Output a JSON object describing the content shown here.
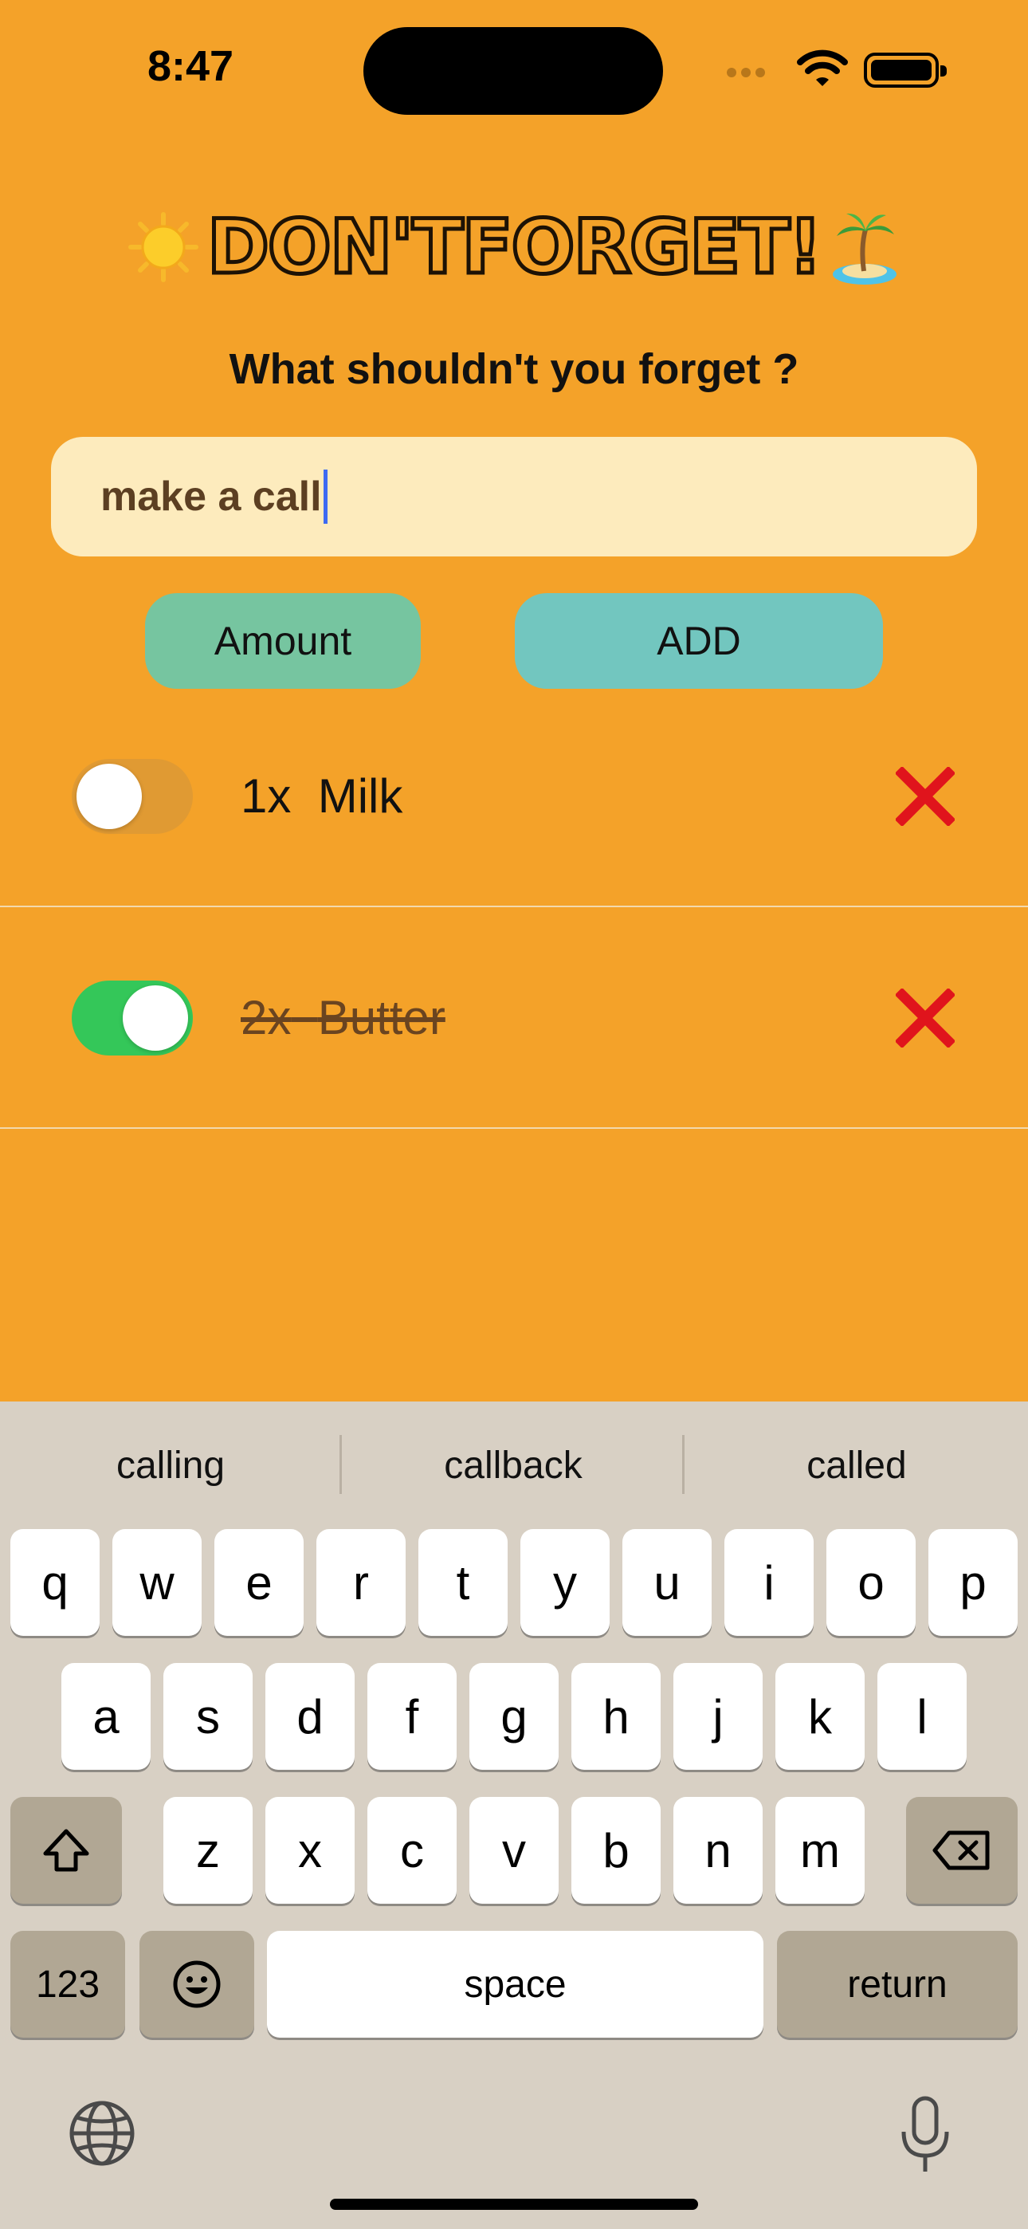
{
  "status_bar": {
    "time": "8:47"
  },
  "header": {
    "title": "Don'tForget!",
    "prompt": "What shouldn't you forget ?"
  },
  "entry": {
    "value": "make a call"
  },
  "buttons": {
    "amount": "Amount",
    "add": "ADD"
  },
  "items": [
    {
      "quantity": "1x",
      "name": "Milk",
      "done": false
    },
    {
      "quantity": "2x",
      "name": "Butter",
      "done": true
    }
  ],
  "keyboard": {
    "suggestions": [
      "calling",
      "callback",
      "called"
    ],
    "row1": [
      "q",
      "w",
      "e",
      "r",
      "t",
      "y",
      "u",
      "i",
      "o",
      "p"
    ],
    "row2": [
      "a",
      "s",
      "d",
      "f",
      "g",
      "h",
      "j",
      "k",
      "l"
    ],
    "row3": [
      "z",
      "x",
      "c",
      "v",
      "b",
      "n",
      "m"
    ],
    "numbers_key": "123",
    "space_key": "space",
    "return_key": "return"
  },
  "colors": {
    "background": "#f4a229",
    "input_bg": "#fdebbd",
    "amount_btn": "#76c5a0",
    "add_btn": "#72c6bf",
    "toggle_on": "#34c759",
    "delete": "#e0141c",
    "keyboard_bg": "#d8d0c4"
  },
  "icons": [
    "sun-icon",
    "island-icon",
    "wifi-icon",
    "battery-icon",
    "delete-x-icon",
    "shift-icon",
    "backspace-icon",
    "emoji-icon",
    "globe-icon",
    "microphone-icon"
  ]
}
